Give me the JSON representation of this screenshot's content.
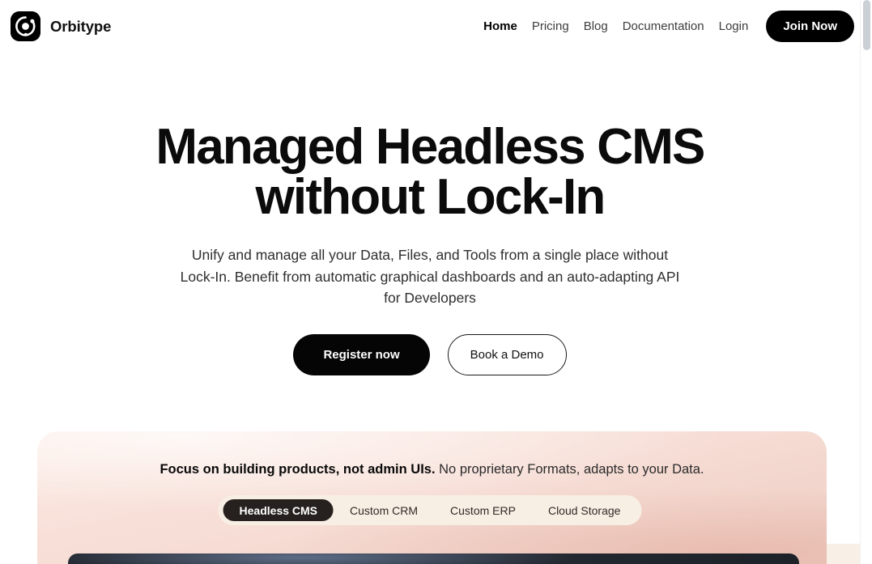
{
  "brand": {
    "name": "Orbitype",
    "logo_icon": "orbit-logo-icon",
    "logo_color": "#000000"
  },
  "nav": {
    "items": [
      {
        "label": "Home",
        "active": true
      },
      {
        "label": "Pricing",
        "active": false
      },
      {
        "label": "Blog",
        "active": false
      },
      {
        "label": "Documentation",
        "active": false
      },
      {
        "label": "Login",
        "active": false
      }
    ],
    "cta_label": "Join Now",
    "cta_color": "#000000"
  },
  "hero": {
    "title": "Managed Headless CMS without Lock-In",
    "subtitle": "Unify and manage all your Data, Files, and Tools from a single place without Lock-In. Benefit from automatic graphical dashboards and an auto-adapting API for Developers",
    "primary_cta": "Register now",
    "secondary_cta": "Book a Demo"
  },
  "showcase": {
    "tagline_bold": "Focus on building products, not admin UIs.",
    "tagline_rest": "No proprietary Formats, adapts to your Data.",
    "tabs": [
      {
        "label": "Headless CMS",
        "active": true
      },
      {
        "label": "Custom CRM",
        "active": false
      },
      {
        "label": "Custom ERP",
        "active": false
      },
      {
        "label": "Cloud Storage",
        "active": false
      }
    ],
    "background_color": "#f7ded6",
    "tab_track_color": "#f8efe4",
    "tab_active_color": "#26211e"
  },
  "scrollbar": {
    "thumb_color": "#cbd0d7"
  }
}
